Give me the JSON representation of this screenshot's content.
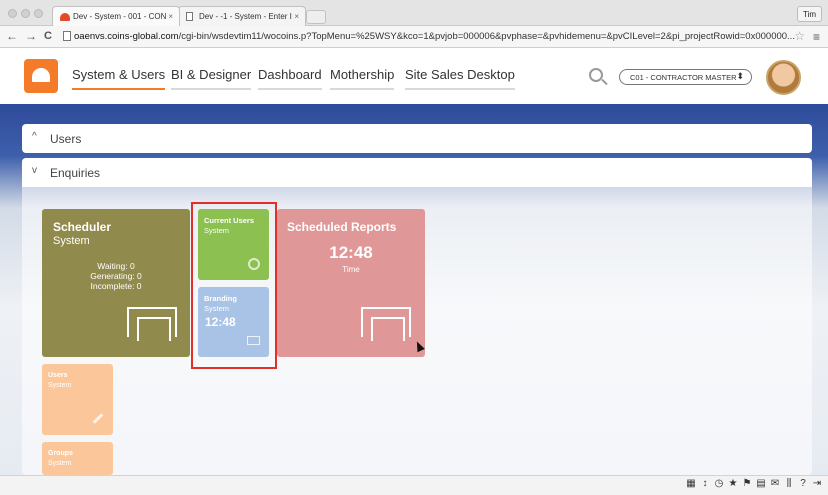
{
  "browser": {
    "tabs": [
      {
        "label": "Dev - System - 001 - CON",
        "close": "×"
      },
      {
        "label": "Dev - -1 - System - Enter I",
        "close": "×"
      }
    ],
    "profile": "Tim",
    "url_host": "oaenvs.coins-global.com",
    "url_path": "/cgi-bin/wsdevtim11/wocoins.p?TopMenu=%25WSY&kco=1&pvjob=000006&pvphase=&pvhidemenu=&pvCILevel=2&pi_projectRowid=0x000000...",
    "nav": {
      "back": "←",
      "forward": "→",
      "reload": "C"
    },
    "star": "☆",
    "menu": "≡"
  },
  "header": {
    "nav_items": [
      "System & Users",
      "BI & Designer",
      "Dashboard",
      "Mothership",
      "Site Sales Desktop"
    ],
    "company_select": "C01 - CONTRACTOR MASTER",
    "select_arrow": "⬍"
  },
  "panels": {
    "users": {
      "label": "Users",
      "chevron": "^"
    },
    "enquiries": {
      "label": "Enquiries",
      "chevron": "v"
    }
  },
  "tiles": {
    "scheduler": {
      "title": "Scheduler",
      "subtitle": "System",
      "waiting": "Waiting: 0",
      "generating": "Generating: 0",
      "incomplete": "Incomplete: 0"
    },
    "current_users": {
      "title": "Current Users",
      "subtitle": "System"
    },
    "branding": {
      "title": "Branding",
      "subtitle": "System",
      "time": "12:48"
    },
    "scheduled_reports": {
      "title": "Scheduled Reports",
      "time": "12:48",
      "time_label": "Time"
    },
    "users": {
      "title": "Users",
      "subtitle": "System"
    },
    "groups": {
      "title": "Groups",
      "subtitle": "System"
    }
  },
  "toolbar_icons": [
    "▦",
    "↕",
    "◷",
    "★",
    "⚑",
    "▤",
    "✉",
    "⫼",
    "?",
    "⇥"
  ],
  "colors": {
    "accent": "#f47b2a",
    "scheduler": "#918a4d",
    "current_users": "#8cc051",
    "branding": "#a8c3e6",
    "scheduled_reports": "#e09797",
    "users_tile": "#fbc79a",
    "highlight": "#e0302a"
  }
}
